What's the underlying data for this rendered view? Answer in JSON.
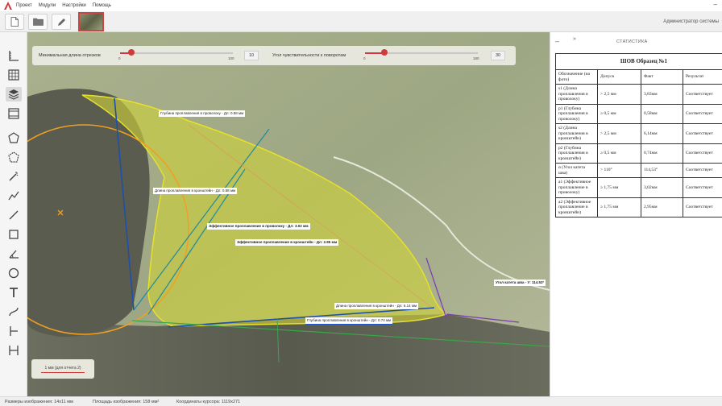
{
  "menu": {
    "items": [
      "Проект",
      "Модули",
      "Настройки",
      "Помощь"
    ],
    "minimize": "–"
  },
  "toolbar": {
    "buttons": [
      "new-file-icon",
      "open-folder-icon",
      "pencil-icon"
    ],
    "user": "Администратор системы"
  },
  "tools": [
    "ruler-icon",
    "grid-icon",
    "layers-icon",
    "frame-icon",
    "polygon-icon",
    "auto-polygon-icon",
    "magic-wand-icon",
    "polyline-icon",
    "line-icon",
    "rectangle-icon",
    "angle-icon",
    "circle-icon",
    "text-icon",
    "curve-icon",
    "vertical-measure-icon",
    "horizontal-measure-icon"
  ],
  "sliders": {
    "min_length": {
      "label": "Минимальная длина отрезков",
      "min": "0",
      "max": "100",
      "value": "10",
      "level": 0.1
    },
    "rotation": {
      "label": "Угол чувствительности к поворотам",
      "min": "0",
      "max": "180",
      "value": "30",
      "level": 0.17
    }
  },
  "annotations": {
    "depth_wire": "Глубина проплавления в проволоку - Дл: 0.58 мм",
    "depth_bracket": "Длина проплавления в кронштейн - Дл: 0.88 мм",
    "eff_wire": "Эффективное проплавление в проволоку - Дл: 3.02 мм",
    "eff_bracket": "Эффективное проплавление в кронштейн - Дл: 2.95 мм",
    "len_bracket": "Длина проплавления в кронштейн - Дл: 6.14 мм",
    "depth_wire2": "Глубина проплавления в кронштейн - Дл: 0.74 мм",
    "angle": "Угол катета шва - У: 114.53°"
  },
  "scale": {
    "label": "1 мм (для отчета 2)"
  },
  "stats": {
    "panel_title": "СТАТИСТИКА",
    "collapse": "–",
    "expand": "»",
    "caption": "ШОВ Образец №1",
    "headers": [
      "Обозначение (на фото)",
      "Допуск",
      "Факт",
      "Результат"
    ],
    "rows": [
      {
        "name": "s1 (Длина проплавления в проволоку)",
        "tol": "> 2,5 мм",
        "fact": "3,83мм",
        "res": "Соответствует"
      },
      {
        "name": "p1 (Глубина проплавления в проволоку)",
        "tol": "≥ 0,5 мм",
        "fact": "0,58мм",
        "res": "Соответствует"
      },
      {
        "name": "s2 (Длина проплавления в кронштейн)",
        "tol": "> 2,5 мм",
        "fact": "6,14мм",
        "res": "Соответствует"
      },
      {
        "name": "p2 (Глубина проплавления в кронштейн)",
        "tol": "≥ 0,5 мм",
        "fact": "0,74мм",
        "res": "Соответствует"
      },
      {
        "name": "α (Угол катета шва)",
        "tol": "> 110°",
        "fact": "114,53°",
        "res": "Соответствует"
      },
      {
        "name": "a1 (Эффективное проплавление в проволоку)",
        "tol": "≥ 1,75 мм",
        "fact": "3,02мм",
        "res": "Соответствует"
      },
      {
        "name": "a2 (Эффективное проплавление в кронштейн)",
        "tol": "≥ 1,75 мм",
        "fact": "2,95мм",
        "res": "Соответствует"
      }
    ]
  },
  "status": {
    "size": "Размеры изображения: 14х11 мм",
    "area": "Площадь изображения: 158 мм²",
    "cursor": "Координаты курсора: 1119x271"
  },
  "colors": {
    "weld_fill": "#cfd23a",
    "weld_stroke": "#e6e12a",
    "wire_circle": "#f0a020",
    "measure_blue": "#1f4fa8",
    "measure_teal": "#1f8aa0",
    "accent_red": "#d13a3a"
  }
}
